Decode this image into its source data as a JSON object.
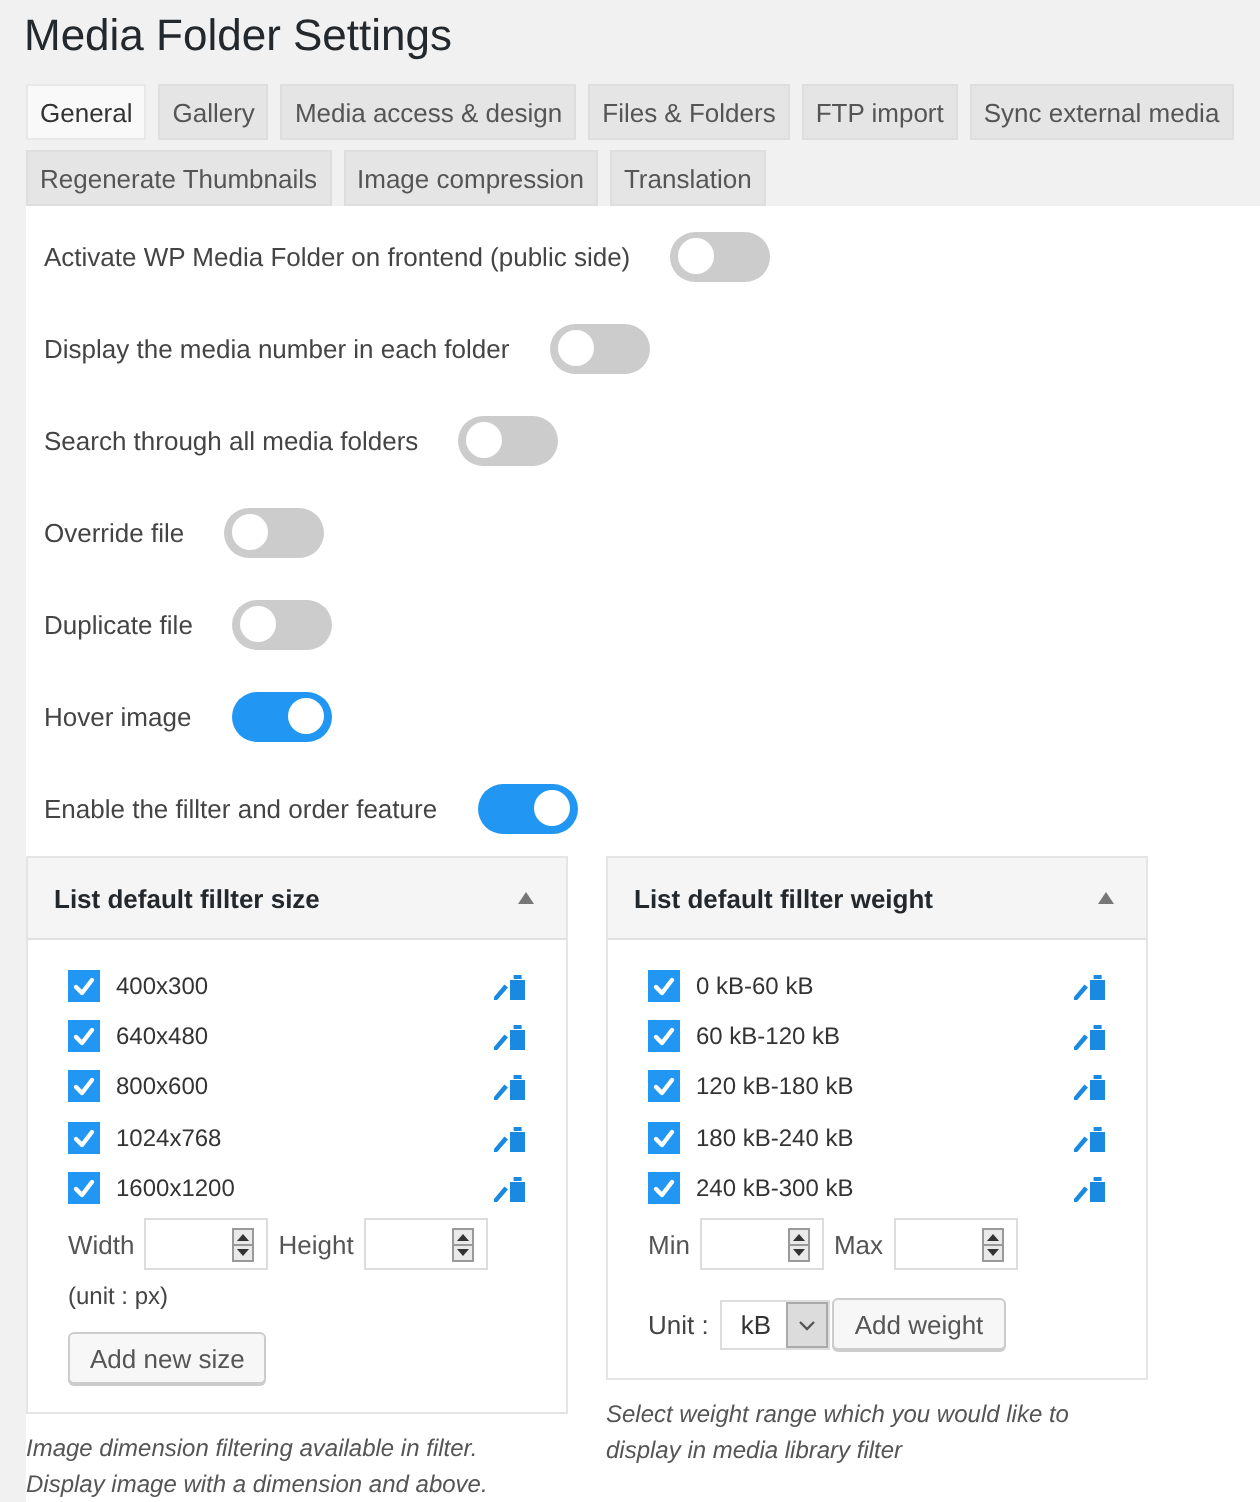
{
  "page_title": "Media Folder Settings",
  "tabs": [
    {
      "label": "General",
      "selected": true
    },
    {
      "label": "Gallery",
      "selected": false
    },
    {
      "label": "Media access & design",
      "selected": false
    },
    {
      "label": "Files & Folders",
      "selected": false
    },
    {
      "label": "FTP import",
      "selected": false
    },
    {
      "label": "Sync external media",
      "selected": false
    },
    {
      "label": "Regenerate Thumbnails",
      "selected": false
    },
    {
      "label": "Image compression",
      "selected": false
    },
    {
      "label": "Translation",
      "selected": false
    }
  ],
  "settings": [
    {
      "label": "Activate WP Media Folder on frontend (public side)",
      "on": false
    },
    {
      "label": "Display the media number in each folder",
      "on": false
    },
    {
      "label": "Search through all media folders",
      "on": false
    },
    {
      "label": "Override file",
      "on": false
    },
    {
      "label": "Duplicate file",
      "on": false
    },
    {
      "label": "Hover image",
      "on": true
    },
    {
      "label": "Enable the fillter and order feature",
      "on": true
    }
  ],
  "panels": [
    {
      "title": "List default fillter size",
      "expanded": true,
      "items": [
        {
          "label": "400x300",
          "checked": true
        },
        {
          "label": "640x480",
          "checked": true
        },
        {
          "label": "800x600",
          "checked": true
        },
        {
          "label": "1024x768",
          "checked": true
        },
        {
          "label": "1600x1200",
          "checked": true
        }
      ],
      "fields": [
        {
          "label": "Width"
        },
        {
          "label": "Height"
        }
      ],
      "note": "(unit : px)",
      "button": "Add new size",
      "caption_lines": [
        "Image dimension filtering available in filter.",
        "Display image with a dimension and above."
      ]
    },
    {
      "title": "List default fillter weight",
      "expanded": true,
      "items": [
        {
          "label": "0 kB-60 kB",
          "checked": true
        },
        {
          "label": "60 kB-120 kB",
          "checked": true
        },
        {
          "label": "120 kB-180 kB",
          "checked": true
        },
        {
          "label": "180 kB-240 kB",
          "checked": true
        },
        {
          "label": "240 kB-300 kB",
          "checked": true
        }
      ],
      "fields": [
        {
          "label": "Min"
        },
        {
          "label": "Max"
        }
      ],
      "unit": {
        "label": "Unit :",
        "value": "kB"
      },
      "button": "Add weight",
      "caption_lines": [
        "Select weight range which you would like to",
        "display in media library filter"
      ]
    }
  ]
}
